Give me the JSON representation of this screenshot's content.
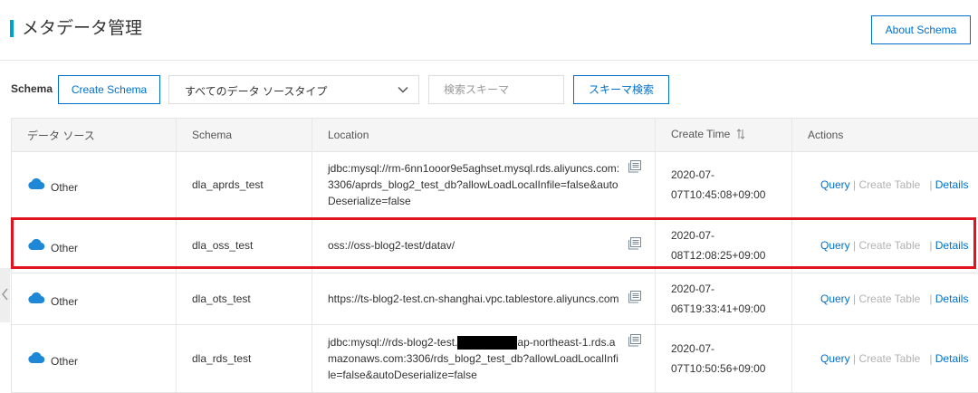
{
  "header": {
    "title": "メタデータ管理",
    "about_label": "About Schema",
    "accent_color": "#00a2ca"
  },
  "toolbar": {
    "schema_label": "Schema",
    "create_label": "Create Schema",
    "source_select_value": "すべてのデータ ソースタイプ",
    "search_placeholder": "検索スキーマ",
    "search_label": "スキーマ検索"
  },
  "table": {
    "columns": {
      "source": "データ ソース",
      "schema": "Schema",
      "location": "Location",
      "create_time": "Create Time",
      "actions": "Actions"
    },
    "action_labels": {
      "query": "Query",
      "create_table": "Create Table",
      "details": "Details"
    },
    "rows": [
      {
        "source": "Other",
        "schema": "dla_aprds_test",
        "location": "jdbc:mysql://rm-6nn1ooor9e5aghset.mysql.rds.aliyuncs.com:3306/aprds_blog2_test_db?allowLoadLocalInfile=false&autoDeserialize=false",
        "ctime_date": "2020-07-",
        "ctime_time": "07T10:45:08+09:00"
      },
      {
        "source": "Other",
        "schema": "dla_oss_test",
        "location": "oss://oss-blog2-test/datav/",
        "ctime_date": "2020-07-",
        "ctime_time": "08T12:08:25+09:00"
      },
      {
        "source": "Other",
        "schema": "dla_ots_test",
        "location": "https://ts-blog2-test.cn-shanghai.vpc.tablestore.aliyuncs.com",
        "ctime_date": "2020-07-",
        "ctime_time": "06T19:33:41+09:00"
      },
      {
        "source": "Other",
        "schema": "dla_rds_test",
        "location_before": "jdbc:mysql://rds-blog2-test.",
        "location_after": "ap-northeast-1.rds.amazonaws.com:3306/rds_blog2_test_db?allowLoadLocalInfile=false&autoDeserialize=false",
        "ctime_date": "2020-07-",
        "ctime_time": "07T10:50:56+09:00"
      }
    ]
  },
  "colors": {
    "link": "#0070cc",
    "highlight": "#e0141e",
    "cloud_icon": "#1e88d6"
  },
  "icons": [
    "cloud-icon",
    "copy-icon",
    "sort-icon",
    "chevron-down-icon",
    "chevron-left-icon"
  ]
}
